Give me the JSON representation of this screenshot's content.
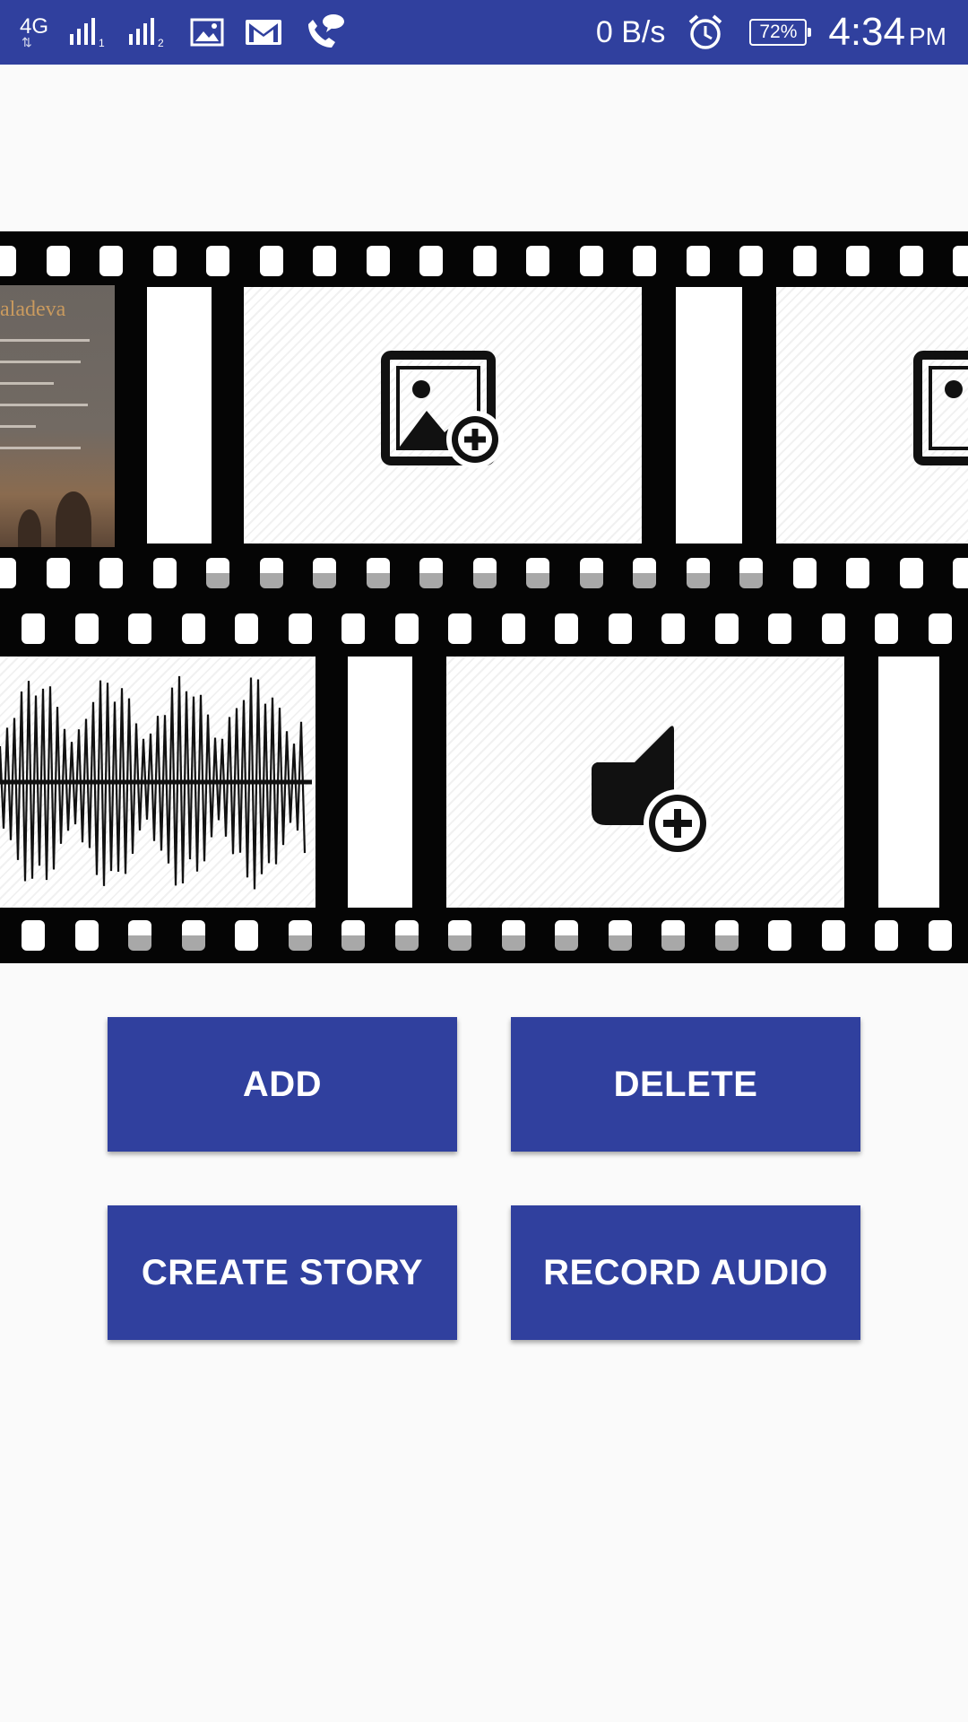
{
  "status_bar": {
    "network_type": "4G",
    "sim1_label": "1",
    "sim2_label": "2",
    "data_speed": "0 B/s",
    "battery_percent": "72%",
    "time": "4:34",
    "ampm": "PM",
    "icons": [
      "network-4g-icon",
      "signal-sim1-icon",
      "signal-sim2-icon",
      "image-notification-icon",
      "gmail-icon",
      "call-message-icon",
      "alarm-icon",
      "battery-icon"
    ]
  },
  "film_strip": {
    "top_frames": [
      "image-thumbnail",
      "add-image",
      "add-image"
    ],
    "bottom_frames": [
      "audio-waveform",
      "add-audio"
    ],
    "thumbnail_title": "aladeva"
  },
  "actions": {
    "add_label": "ADD",
    "delete_label": "DELETE",
    "create_story_label": "CREATE STORY",
    "record_audio_label": "RECORD AUDIO"
  },
  "colors": {
    "primary": "#30409e",
    "background": "#fafafa",
    "film": "#050505"
  }
}
